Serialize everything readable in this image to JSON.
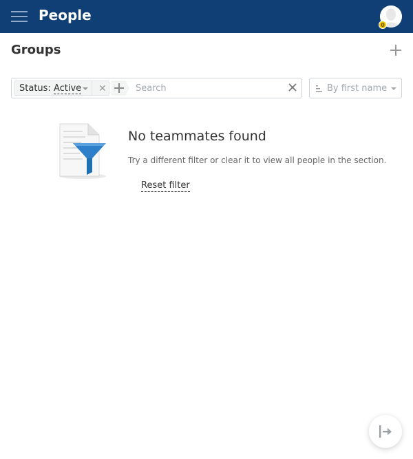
{
  "header": {
    "title": "People",
    "badge_count": "0"
  },
  "section": {
    "title": "Groups"
  },
  "filter": {
    "chip_label": "Status:",
    "chip_value": "Active",
    "search_placeholder": "Search",
    "sort_label": "By first name"
  },
  "empty_state": {
    "title": "No teammates found",
    "description": "Try a different filter or clear it to view all people in the section.",
    "reset_label": "Reset filter"
  },
  "icons": {
    "menu": "hamburger-icon",
    "avatar": "avatar-icon",
    "add": "plus-icon",
    "close": "close-icon",
    "sort": "sort-icon",
    "empty": "filter-document-icon",
    "logout": "logout-icon"
  },
  "colors": {
    "header_bg": "#0f3f75",
    "accent_blue": "#2d7fc9",
    "badge": "#f2c400"
  }
}
